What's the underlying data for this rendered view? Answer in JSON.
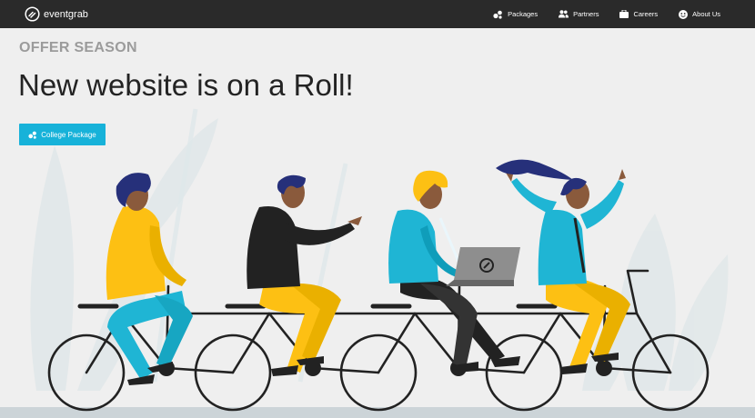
{
  "brand": {
    "name": "eventgrab",
    "logo_icon": "eventgrab-logo-icon"
  },
  "nav": {
    "items": [
      {
        "label": "Packages",
        "icon": "packages-icon"
      },
      {
        "label": "Partners",
        "icon": "partners-icon"
      },
      {
        "label": "Careers",
        "icon": "briefcase-icon"
      },
      {
        "label": "About Us",
        "icon": "smiley-icon"
      }
    ]
  },
  "hero": {
    "eyebrow": "OFFER SEASON",
    "headline": "New website is on a Roll!",
    "cta_label": "College Package",
    "cta_icon": "packages-icon"
  },
  "colors": {
    "navbar": "#2a2a2a",
    "background": "#efefef",
    "accent": "#17b2d9",
    "yellow": "#fdc013",
    "cyan": "#1fb5d4"
  }
}
